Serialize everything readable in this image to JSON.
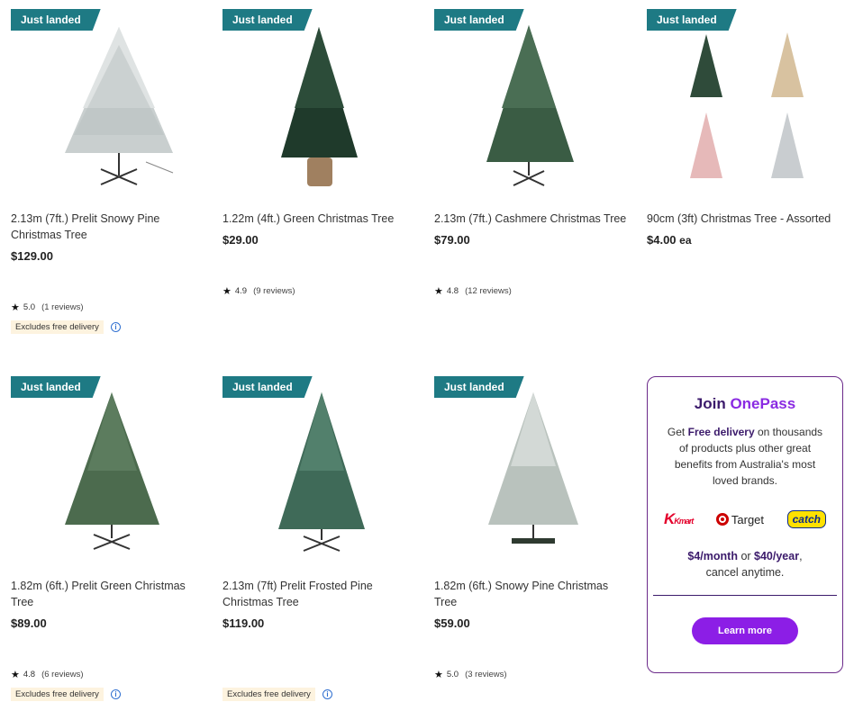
{
  "products": [
    {
      "badge": "Just landed",
      "title": "2.13m (7ft.) Prelit Snowy Pine Christmas Tree",
      "price": "$129.00",
      "rating": "5.0",
      "reviews": "(1 reviews)",
      "excludes": "Excludes free delivery",
      "image": "snowy-prelit-tree"
    },
    {
      "badge": "Just landed",
      "title": "1.22m (4ft.) Green Christmas Tree",
      "price": "$29.00",
      "rating": "4.9",
      "reviews": "(9 reviews)",
      "image": "green-tree-potted"
    },
    {
      "badge": "Just landed",
      "title": "2.13m (7ft.) Cashmere Christmas Tree",
      "price": "$79.00",
      "rating": "4.8",
      "reviews": "(12 reviews)",
      "image": "cashmere-tree"
    },
    {
      "badge": "Just landed",
      "title": "90cm (3ft) Christmas Tree - Assorted",
      "price": "$4.00",
      "price_suffix": "ea",
      "image": "assorted-small-trees"
    },
    {
      "badge": "Just landed",
      "title": "1.82m (6ft.) Prelit Green Christmas Tree",
      "price": "$89.00",
      "rating": "4.8",
      "reviews": "(6 reviews)",
      "excludes": "Excludes free delivery",
      "image": "prelit-green-tree"
    },
    {
      "badge": "Just landed",
      "title": "2.13m (7ft) Prelit Frosted Pine Christmas Tree",
      "price": "$119.00",
      "excludes": "Excludes free delivery",
      "image": "frosted-pine-tree"
    },
    {
      "badge": "Just landed",
      "title": "1.82m (6ft.) Snowy Pine Christmas Tree",
      "price": "$59.00",
      "rating": "5.0",
      "reviews": "(3 reviews)",
      "image": "snowy-pine-tree"
    }
  ],
  "onepass": {
    "join": "Join",
    "brand": "OnePass",
    "text_pre": "Get ",
    "text_bold": "Free delivery",
    "text_post": " on thousands of products plus other great benefits from Australia's most loved brands.",
    "logos": [
      "Kmart",
      "Target",
      "catch"
    ],
    "price_month": "$4/month",
    "price_or": " or ",
    "price_year": "$40/year",
    "price_post": ",",
    "cancel": "cancel anytime.",
    "button": "Learn more"
  },
  "colors": {
    "badge": "#1e7a84",
    "onepass_purple": "#8c1ee6",
    "onepass_border": "#6b2a8a"
  }
}
